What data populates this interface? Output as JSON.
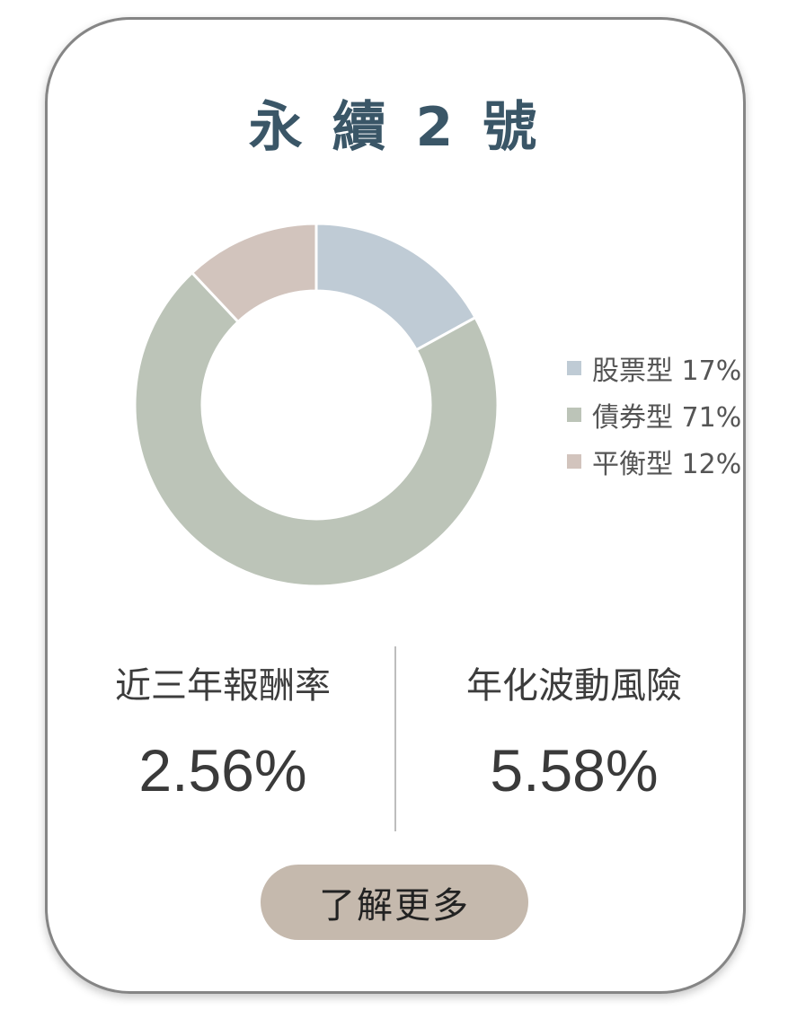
{
  "card": {
    "title": "永 續 2 號"
  },
  "chart_data": {
    "type": "pie",
    "donut": true,
    "categories": [
      "股票型",
      "債券型",
      "平衡型"
    ],
    "values": [
      17,
      71,
      12
    ],
    "colors": [
      "#bfcbd5",
      "#bcc4b8",
      "#d2c4bd"
    ],
    "legend": [
      {
        "label": "股票型 17%",
        "color": "#bfcbd5"
      },
      {
        "label": "債券型 71%",
        "color": "#bcc4b8"
      },
      {
        "label": "平衡型 12%",
        "color": "#d2c4bd"
      }
    ],
    "legend_position": "right"
  },
  "stats": {
    "return_label": "近三年報酬率",
    "return_value": "2.56%",
    "volatility_label": "年化波動風險",
    "volatility_value": "5.58%"
  },
  "cta": {
    "label": "了解更多"
  }
}
